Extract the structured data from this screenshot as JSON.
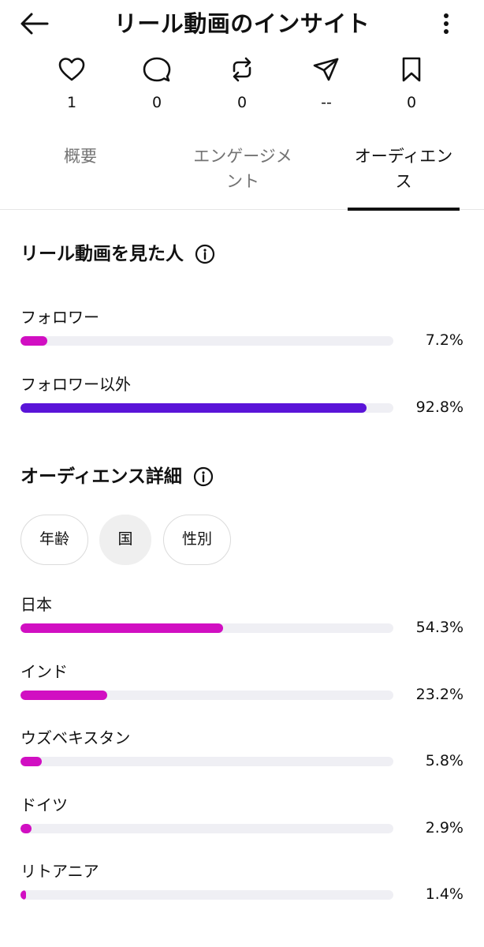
{
  "header": {
    "title": "リール動画のインサイト"
  },
  "stats": [
    {
      "icon": "heart-icon",
      "count": "1"
    },
    {
      "icon": "comment-icon",
      "count": "0"
    },
    {
      "icon": "repost-icon",
      "count": "0"
    },
    {
      "icon": "send-icon",
      "count": "--"
    },
    {
      "icon": "bookmark-icon",
      "count": "0"
    }
  ],
  "tabs": [
    {
      "label": "概要",
      "active": false
    },
    {
      "label": "エンゲージメ\nント",
      "active": false
    },
    {
      "label": "オーディエン\nス",
      "active": true
    }
  ],
  "viewers": {
    "title": "リール動画を見た人",
    "items": [
      {
        "label": "フォロワー",
        "value": "7.2%",
        "fraction": 0.072,
        "color": "#d10fc2"
      },
      {
        "label": "フォロワー以外",
        "value": "92.8%",
        "fraction": 0.928,
        "color": "#5a14d8"
      }
    ]
  },
  "audience": {
    "title": "オーディエンス詳細",
    "filters": [
      {
        "label": "年齢",
        "selected": false
      },
      {
        "label": "国",
        "selected": true
      },
      {
        "label": "性別",
        "selected": false
      }
    ],
    "countries": [
      {
        "label": "日本",
        "value": "54.3%",
        "fraction": 0.543
      },
      {
        "label": "インド",
        "value": "23.2%",
        "fraction": 0.232
      },
      {
        "label": "ウズベキスタン",
        "value": "5.8%",
        "fraction": 0.058
      },
      {
        "label": "ドイツ",
        "value": "2.9%",
        "fraction": 0.029
      },
      {
        "label": "リトアニア",
        "value": "1.4%",
        "fraction": 0.014
      }
    ]
  },
  "colors": {
    "accent_pink": "#d10fc2",
    "accent_purple": "#5a14d8",
    "track": "#efeff4"
  }
}
